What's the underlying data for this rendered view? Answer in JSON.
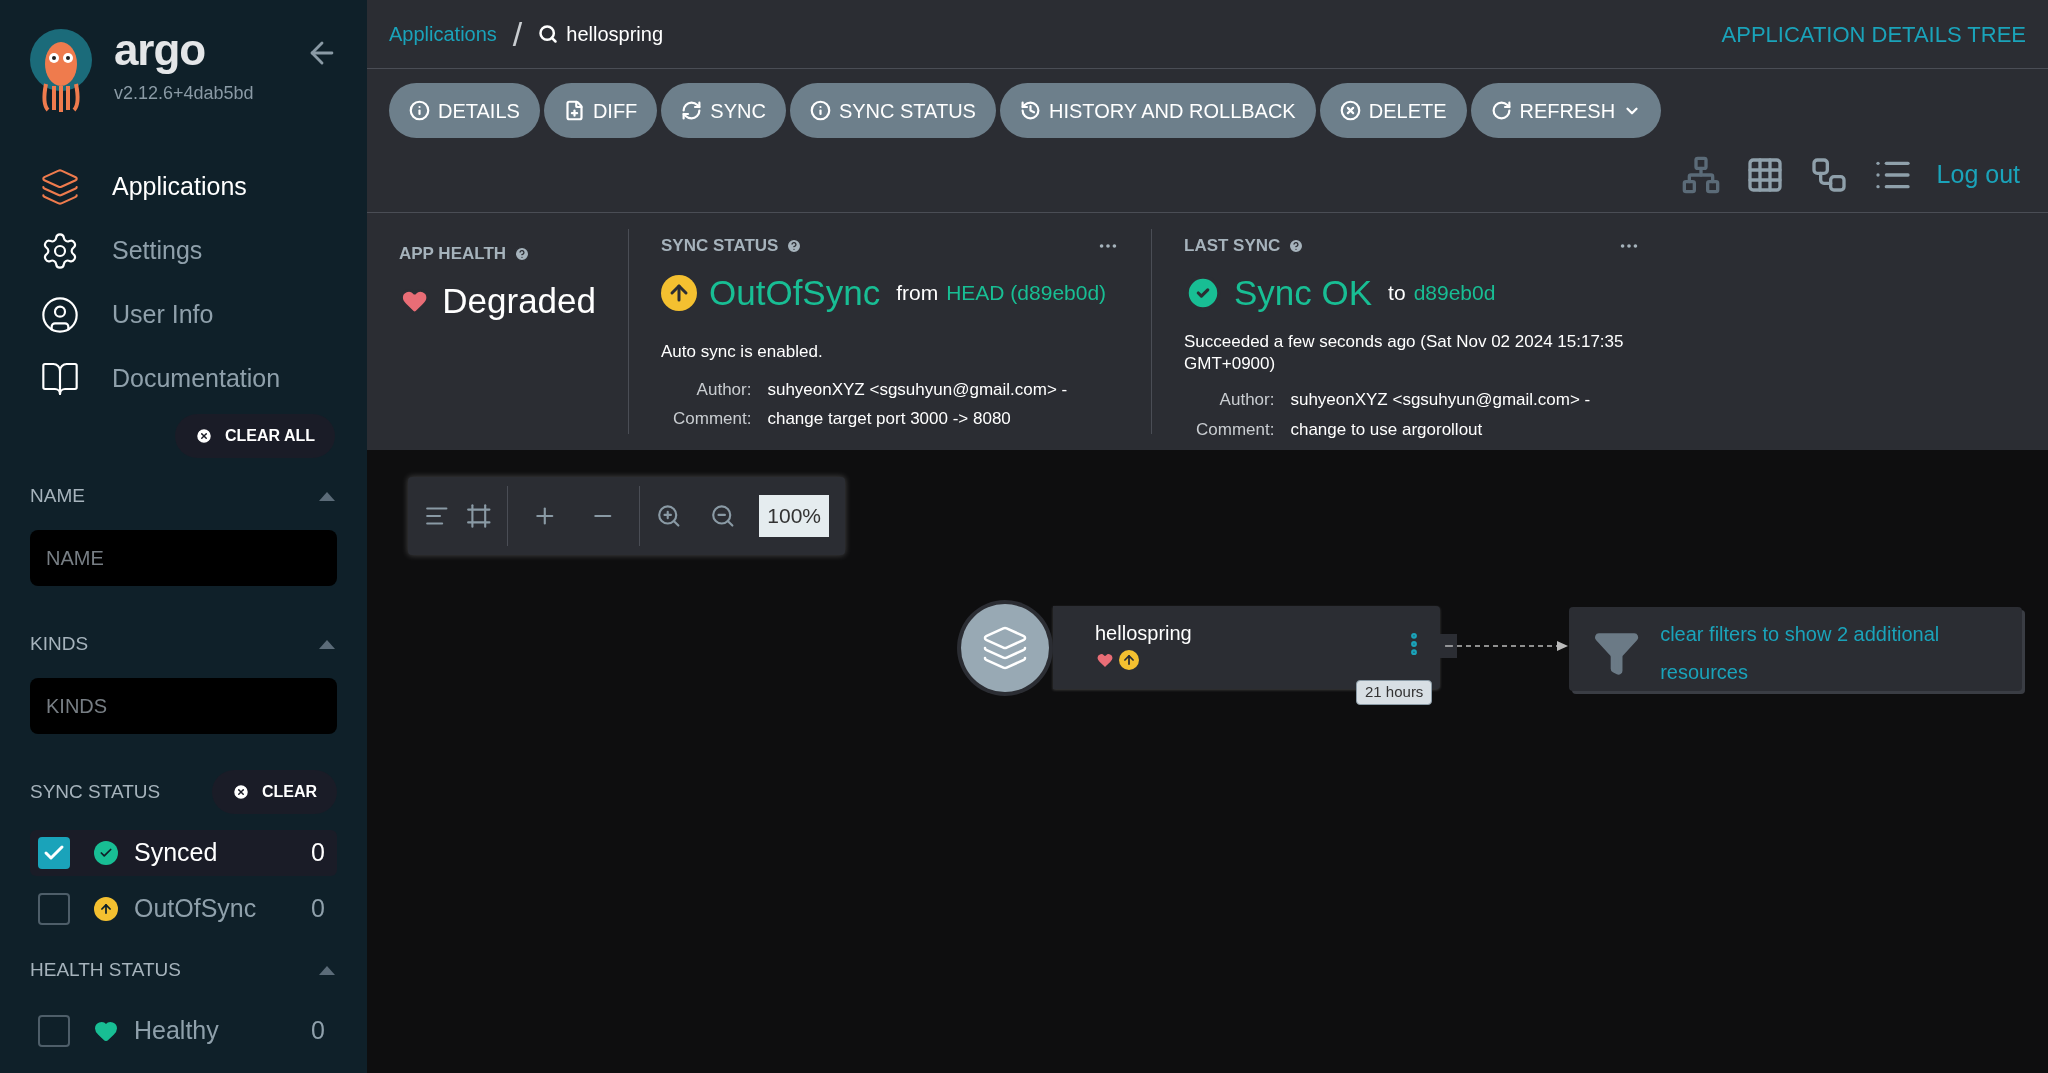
{
  "sidebar": {
    "logo_text": "argo",
    "version": "v2.12.6+4dab5bd",
    "nav": [
      {
        "label": "Applications",
        "selected": true
      },
      {
        "label": "Settings",
        "selected": false
      },
      {
        "label": "User Info",
        "selected": false
      },
      {
        "label": "Documentation",
        "selected": false
      }
    ],
    "clear_all": "CLEAR ALL",
    "filters": [
      {
        "kind": "input",
        "title": "NAME",
        "placeholder": "NAME",
        "expanded": true
      },
      {
        "kind": "input",
        "title": "KINDS",
        "placeholder": "KINDS",
        "expanded": true
      },
      {
        "kind": "checklist",
        "title": "SYNC STATUS",
        "clear": "CLEAR",
        "items": [
          {
            "label": "Synced",
            "kind": "synced",
            "count": "0",
            "checked": true
          },
          {
            "label": "OutOfSync",
            "kind": "outofsync",
            "count": "0",
            "checked": false
          }
        ]
      },
      {
        "kind": "checklist",
        "title": "HEALTH STATUS",
        "expanded": true,
        "items": [
          {
            "label": "Healthy",
            "kind": "healthy",
            "count": "0",
            "checked": false
          }
        ]
      }
    ]
  },
  "breadcrumb": {
    "link": "Applications",
    "separator": "/",
    "current": "hellospring"
  },
  "page_title": "APPLICATION DETAILS TREE",
  "toolbar": [
    {
      "label": "DETAILS"
    },
    {
      "label": "DIFF"
    },
    {
      "label": "SYNC"
    },
    {
      "label": "SYNC STATUS"
    },
    {
      "label": "HISTORY AND ROLLBACK"
    },
    {
      "label": "DELETE"
    },
    {
      "label": "REFRESH",
      "dropdown": true
    }
  ],
  "view_modes": [
    {
      "selected": true
    },
    {
      "selected": false
    },
    {
      "selected": false
    },
    {
      "selected": false
    }
  ],
  "logout": "Log out",
  "status": {
    "app_health": {
      "title": "APP HEALTH",
      "value": "Degraded"
    },
    "sync_status": {
      "title": "SYNC STATUS",
      "value": "OutOfSync",
      "from": "from",
      "revision": "HEAD (d89eb0d)",
      "note": "Auto sync is enabled.",
      "author_label": "Author:",
      "author": "suhyeonXYZ <sgsuhyun@gmail.com> -",
      "comment_label": "Comment:",
      "comment": "change target port 3000 -> 8080"
    },
    "last_sync": {
      "title": "LAST SYNC",
      "value": "Sync OK",
      "to": "to",
      "revision": "d89eb0d",
      "note": "Succeeded a few seconds ago (Sat Nov 02 2024 15:17:35 GMT+0900)",
      "author_label": "Author:",
      "author": "suhyeonXYZ <sgsuhyun@gmail.com> -",
      "comment_label": "Comment:",
      "comment": "change to use argorollout"
    }
  },
  "canvas": {
    "zoom": "100%",
    "node": {
      "name": "hellospring",
      "age": "21 hours"
    },
    "filter_note": "clear filters to show 2 additional resources"
  }
}
